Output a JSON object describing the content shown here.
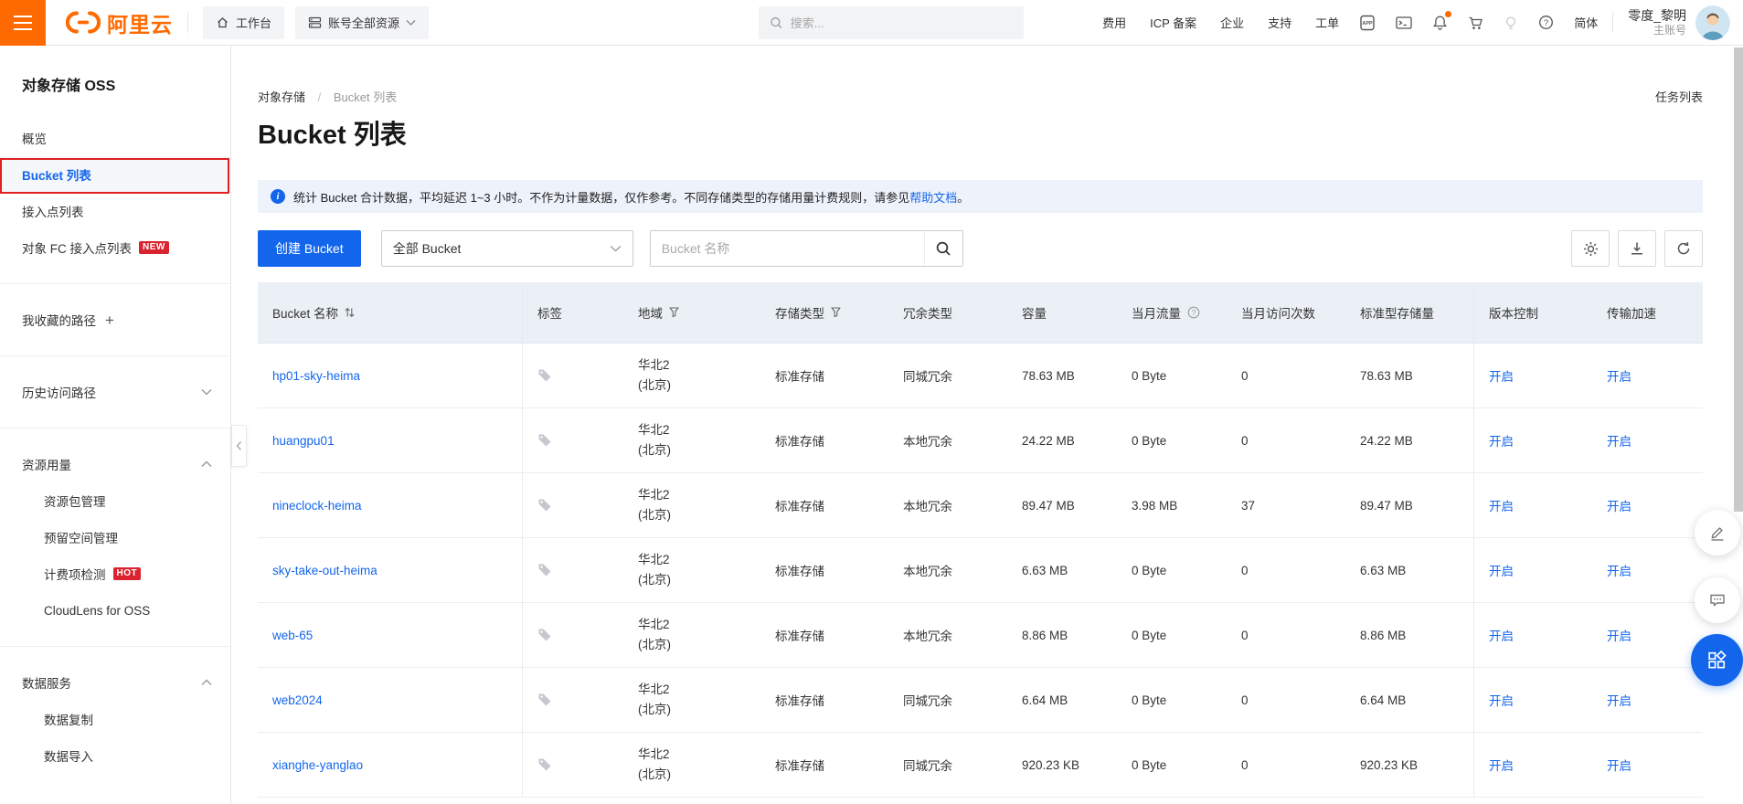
{
  "header": {
    "logo": "阿里云",
    "workbench": "工作台",
    "resources": "账号全部资源",
    "search_placeholder": "搜索...",
    "nav": [
      "费用",
      "ICP 备案",
      "企业",
      "支持",
      "工单"
    ],
    "lang": "简体",
    "user": {
      "name": "零度_黎明",
      "role": "主账号"
    }
  },
  "sidebar": {
    "title": "对象存储 OSS",
    "overview": "概览",
    "bucket_list": "Bucket 列表",
    "access_points": "接入点列表",
    "fc_access_points": "对象 FC 接入点列表",
    "new_badge": "NEW",
    "favorites": "我收藏的路径",
    "favorites_add": "+",
    "history": "历史访问路径",
    "resource_usage": "资源用量",
    "resource_usage_items": [
      "资源包管理",
      "预留空间管理",
      "计费项检测",
      "CloudLens for OSS"
    ],
    "hot_badge": "HOT",
    "data_service": "数据服务",
    "data_service_items": [
      "数据复制",
      "数据导入"
    ]
  },
  "main": {
    "breadcrumb": {
      "root": "对象存储",
      "separator": "/",
      "current": "Bucket 列表"
    },
    "task_list": "任务列表",
    "title": "Bucket 列表",
    "banner": {
      "text": "统计 Bucket 合计数据，平均延迟 1~3 小时。不作为计量数据，仅作参考。不同存储类型的存储用量计费规则，请参见",
      "link": "帮助文档",
      "suffix": "。"
    },
    "toolbar": {
      "create_button": "创建 Bucket",
      "filter_selected": "全部 Bucket",
      "search_placeholder": "Bucket 名称"
    }
  },
  "table": {
    "columns": [
      {
        "label": "Bucket 名称"
      },
      {
        "label": "标签"
      },
      {
        "label": "地域"
      },
      {
        "label": "存储类型"
      },
      {
        "label": "冗余类型"
      },
      {
        "label": "容量"
      },
      {
        "label": "当月流量"
      },
      {
        "label": "当月访问次数"
      },
      {
        "label": "标准型存储量"
      },
      {
        "label": "版本控制"
      },
      {
        "label": "传输加速"
      }
    ],
    "rows": [
      {
        "name": "hp01-sky-heima",
        "region": [
          "华北2",
          "(北京)"
        ],
        "storage_class": "标准存储",
        "redundancy": "同城冗余",
        "capacity": "78.63 MB",
        "monthly_traffic": "0 Byte",
        "monthly_visits": "0",
        "standard_storage": "78.63 MB",
        "versioning": "开启",
        "acceleration": "开启"
      },
      {
        "name": "huangpu01",
        "region": [
          "华北2",
          "(北京)"
        ],
        "storage_class": "标准存储",
        "redundancy": "本地冗余",
        "capacity": "24.22 MB",
        "monthly_traffic": "0 Byte",
        "monthly_visits": "0",
        "standard_storage": "24.22 MB",
        "versioning": "开启",
        "acceleration": "开启"
      },
      {
        "name": "nineclock-heima",
        "region": [
          "华北2",
          "(北京)"
        ],
        "storage_class": "标准存储",
        "redundancy": "本地冗余",
        "capacity": "89.47 MB",
        "monthly_traffic": "3.98 MB",
        "monthly_visits": "37",
        "standard_storage": "89.47 MB",
        "versioning": "开启",
        "acceleration": "开启"
      },
      {
        "name": "sky-take-out-heima",
        "region": [
          "华北2",
          "(北京)"
        ],
        "storage_class": "标准存储",
        "redundancy": "本地冗余",
        "capacity": "6.63 MB",
        "monthly_traffic": "0 Byte",
        "monthly_visits": "0",
        "standard_storage": "6.63 MB",
        "versioning": "开启",
        "acceleration": "开启"
      },
      {
        "name": "web-65",
        "region": [
          "华北2",
          "(北京)"
        ],
        "storage_class": "标准存储",
        "redundancy": "本地冗余",
        "capacity": "8.86 MB",
        "monthly_traffic": "0 Byte",
        "monthly_visits": "0",
        "standard_storage": "8.86 MB",
        "versioning": "开启",
        "acceleration": "开启"
      },
      {
        "name": "web2024",
        "region": [
          "华北2",
          "(北京)"
        ],
        "storage_class": "标准存储",
        "redundancy": "同城冗余",
        "capacity": "6.64 MB",
        "monthly_traffic": "0 Byte",
        "monthly_visits": "0",
        "standard_storage": "6.64 MB",
        "versioning": "开启",
        "acceleration": "开启"
      },
      {
        "name": "xianghe-yanglao",
        "region": [
          "华北2",
          "(北京)"
        ],
        "storage_class": "标准存储",
        "redundancy": "同城冗余",
        "capacity": "920.23 KB",
        "monthly_traffic": "0 Byte",
        "monthly_visits": "0",
        "standard_storage": "920.23 KB",
        "versioning": "开启",
        "acceleration": "开启"
      }
    ]
  },
  "colors": {
    "brand_orange": "#FF6A00",
    "primary_blue": "#1366EC",
    "badge_red": "#D9232E",
    "annotation_red": "#E02020",
    "banner_bg": "#EDF2FB",
    "table_header_bg": "#EBF0F6"
  },
  "icons": {
    "hamburger-icon": "menu bars",
    "aliyun-logo-icon": "(-) bracket mark",
    "home-icon": "house",
    "resources-icon": "server stack",
    "search-icon": "magnifier",
    "app-icon": "APP phone",
    "terminal-icon": ">_",
    "bell-icon": "bell with orange dot",
    "cart-icon": "shopping cart",
    "bulb-icon": "lightbulb",
    "help-icon": "? circle",
    "chevron-down-icon": "⌄",
    "chevron-up-icon": "⌃",
    "collapse-icon": "‹",
    "plus-icon": "+",
    "info-icon": "i circle",
    "sort-icon": "⇅",
    "filter-icon": "funnel",
    "question-icon": "? circle",
    "tag-icon": "price tag",
    "gear-icon": "gear",
    "download-icon": "download arrow",
    "refresh-icon": "circular arrow",
    "pencil-icon": "pencil",
    "chat-icon": "speech bubble",
    "apps-icon": "grid squares with diamond"
  }
}
